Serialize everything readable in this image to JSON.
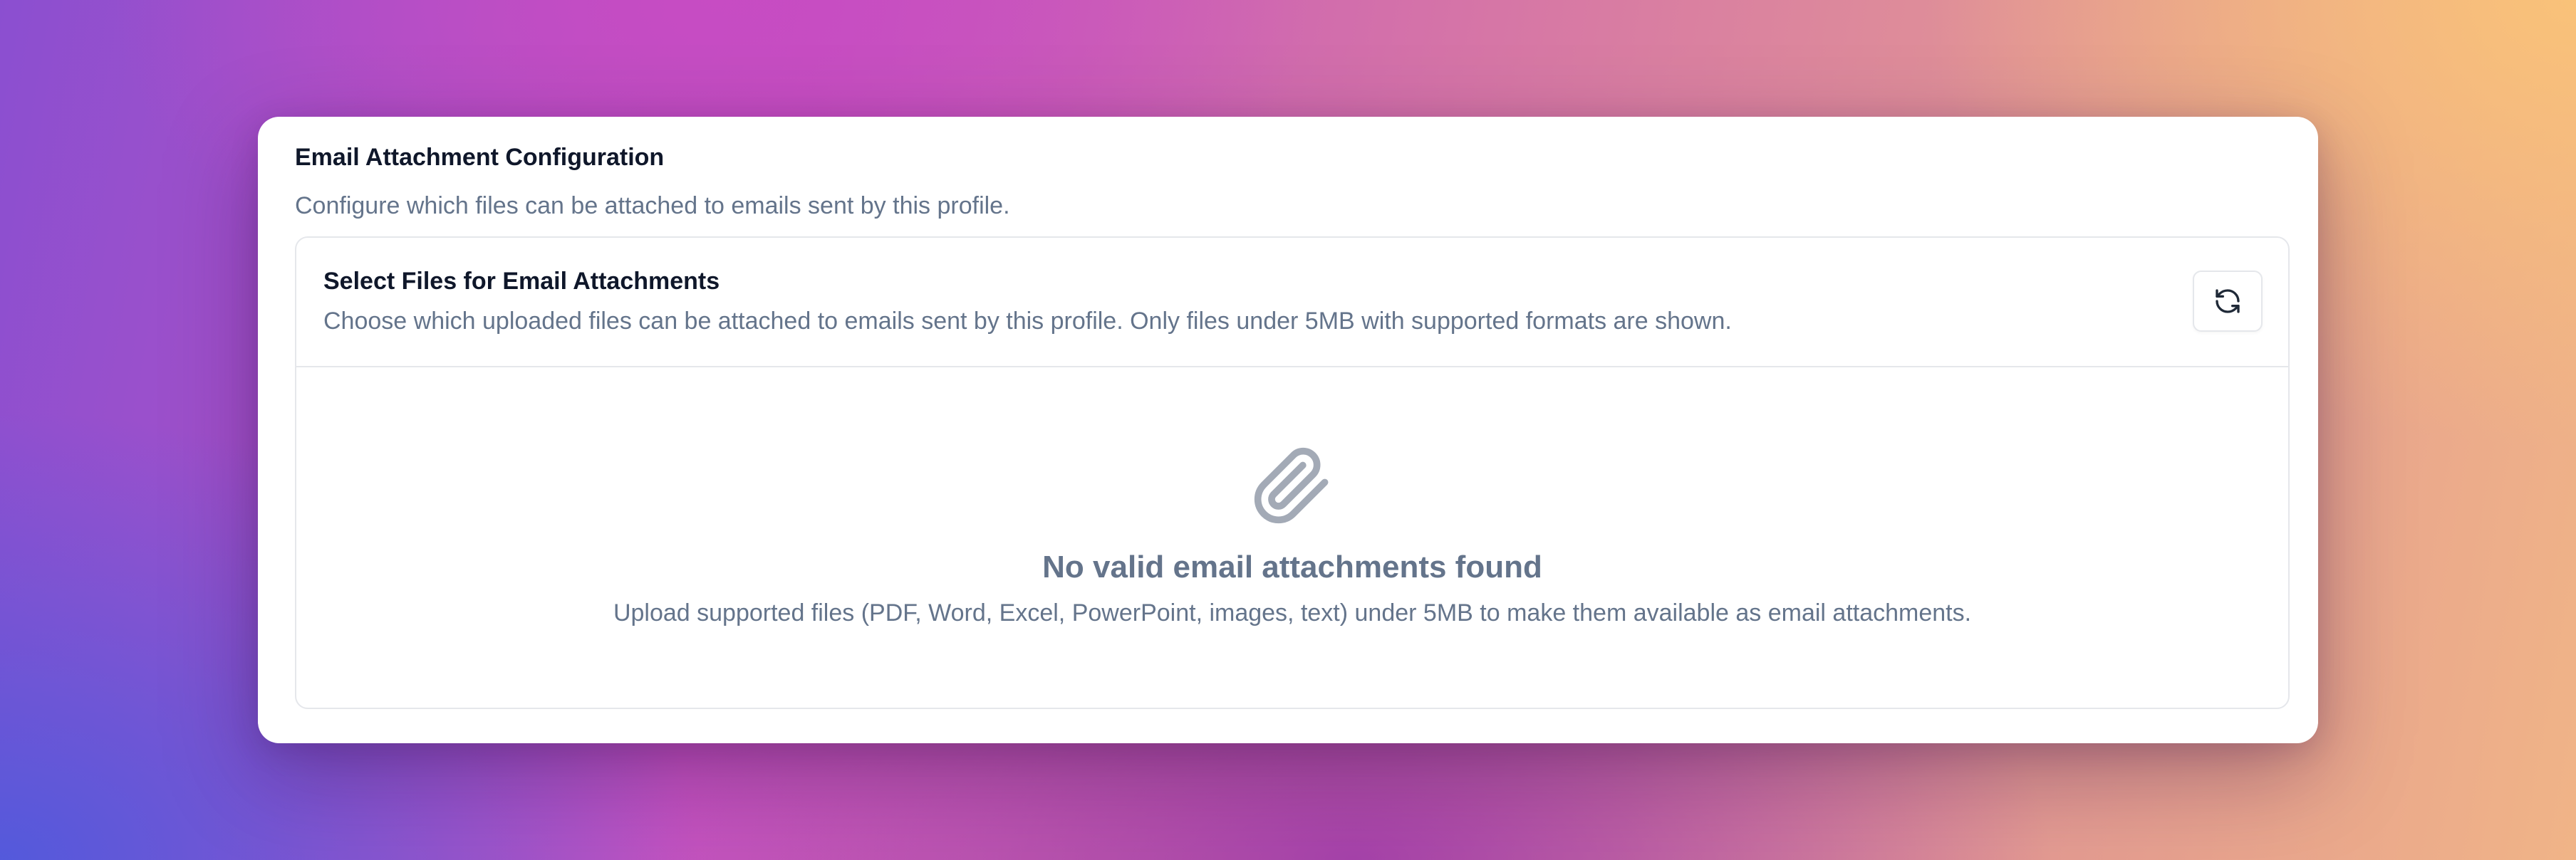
{
  "card": {
    "title": "Email Attachment Configuration",
    "description": "Configure which files can be attached to emails sent by this profile."
  },
  "panel": {
    "title": "Select Files for Email Attachments",
    "description": "Choose which uploaded files can be attached to emails sent by this profile. Only files under 5MB with supported formats are shown.",
    "refresh_icon": "refresh-icon"
  },
  "empty_state": {
    "icon": "paperclip-icon",
    "title": "No valid email attachments found",
    "description": "Upload supported files (PDF, Word, Excel, PowerPoint, images, text) under 5MB to make them available as email attachments."
  },
  "colors": {
    "heading": "#0f172a",
    "muted_text": "#64748b",
    "border": "#e5e7eb",
    "icon_gray": "#a3aab6"
  }
}
